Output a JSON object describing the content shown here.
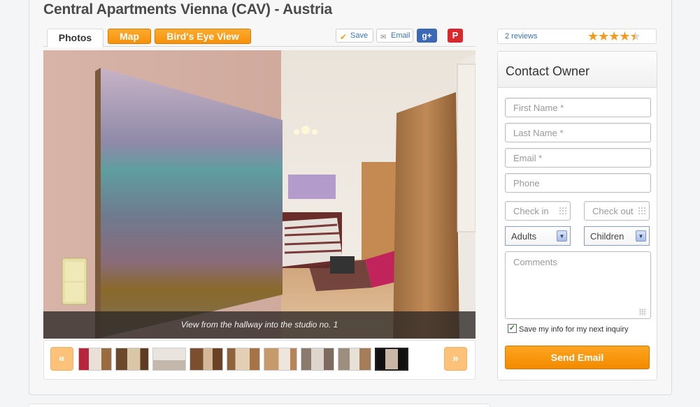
{
  "listing": {
    "title": "Central Apartments Vienna (CAV) - Austria"
  },
  "tabs": [
    {
      "label": "Photos",
      "active": true
    },
    {
      "label": "Map",
      "active": false
    },
    {
      "label": "Bird's Eye View",
      "active": false
    }
  ],
  "actions": {
    "save_label": "Save",
    "email_label": "Email",
    "gplus_label": "g+",
    "pinterest_label": "P"
  },
  "gallery": {
    "caption": "View from the hallway into the studio no. 1",
    "prev_label": "«",
    "next_label": "»",
    "thumbnail_count": 9,
    "active_thumbnail": 9
  },
  "reviews": {
    "link_text": "2 reviews",
    "rating": 4.5,
    "max_rating": 5
  },
  "contact": {
    "title": "Contact Owner",
    "first_name_placeholder": "First Name *",
    "last_name_placeholder": "Last Name *",
    "email_placeholder": "Email *",
    "phone_placeholder": "Phone",
    "checkin_placeholder": "Check in",
    "checkout_placeholder": "Check out",
    "adults_selected": "Adults",
    "children_selected": "Children",
    "comments_placeholder": "Comments",
    "save_info_label": "Save my info for my next inquiry",
    "save_info_checked": true,
    "send_label": "Send Email"
  },
  "colors": {
    "accent": "#f7910a",
    "link": "#3a73b5",
    "star": "#f29a1a"
  }
}
